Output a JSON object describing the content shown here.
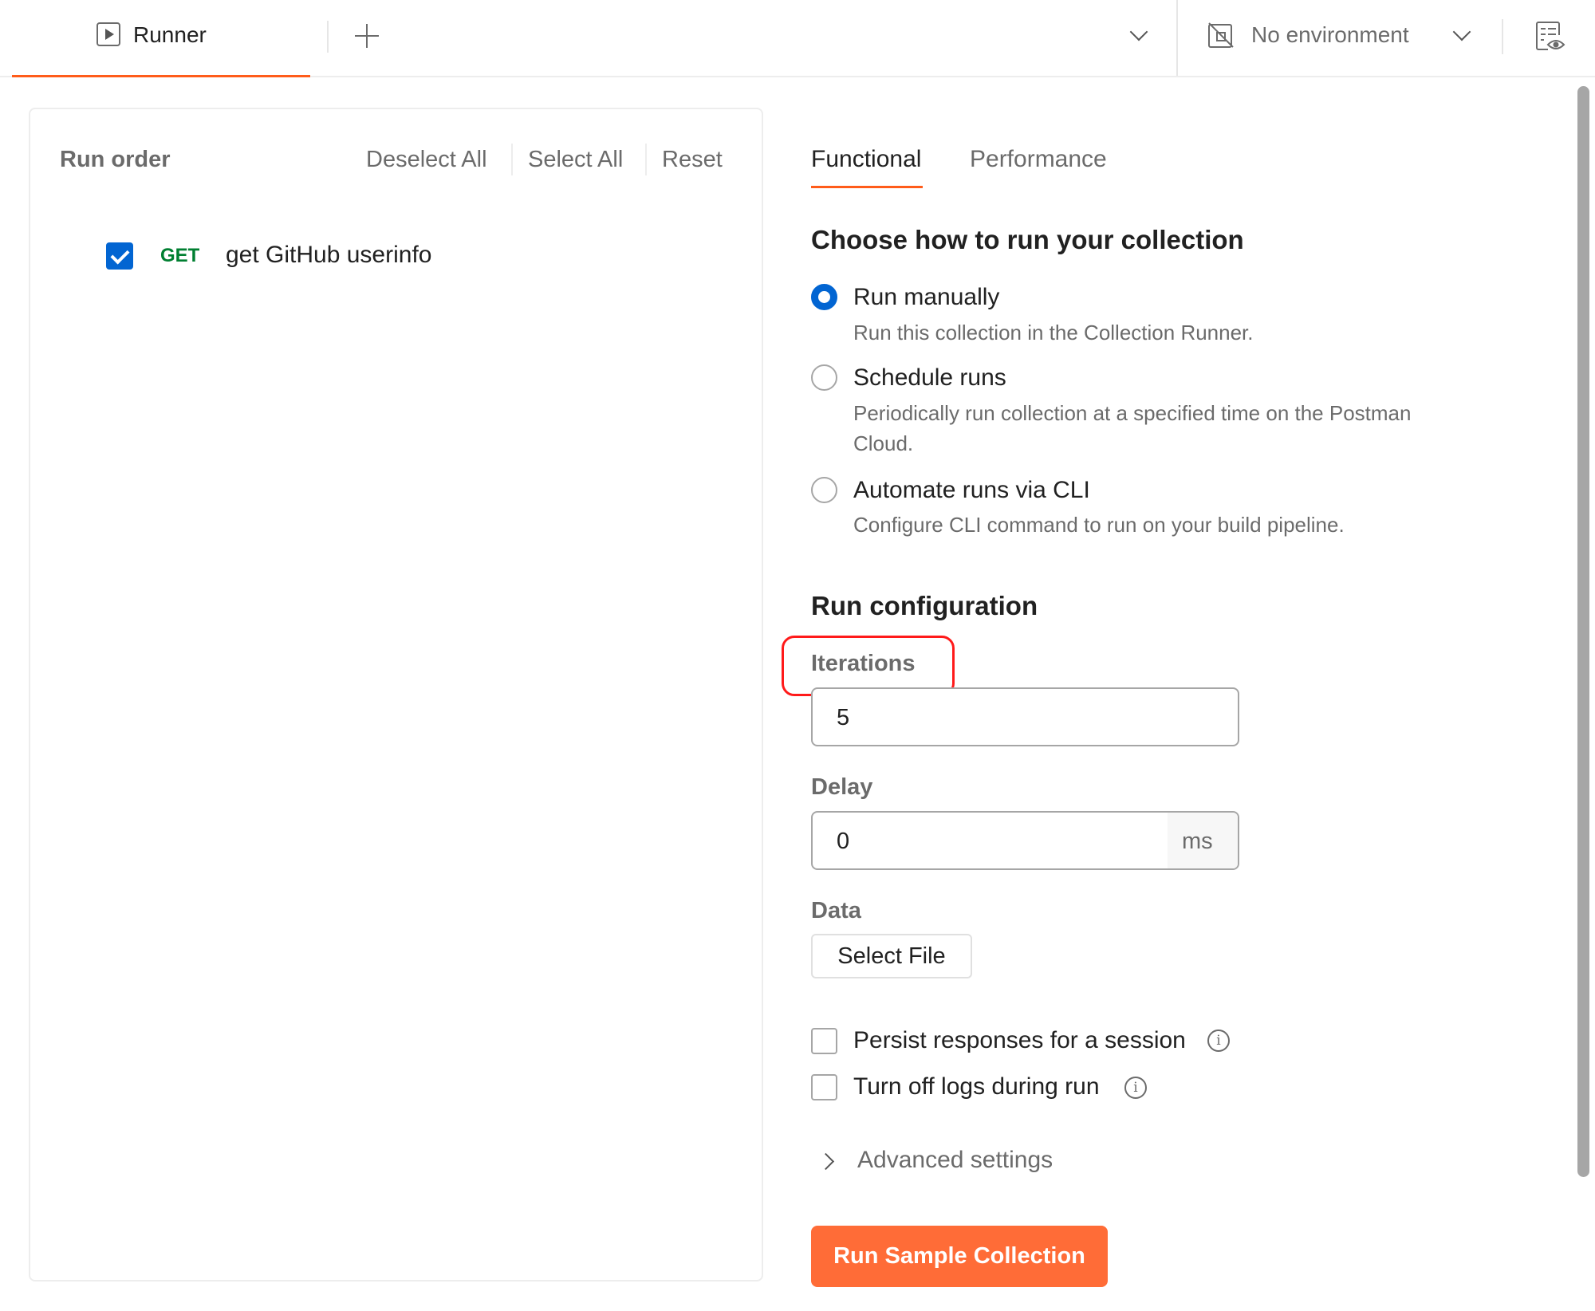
{
  "header": {
    "tab_label": "Runner",
    "tab_icon": "play-square-icon",
    "new_tab_icon": "plus-icon",
    "tabs_menu_icon": "chevron-down-icon",
    "environment": {
      "label": "No environment",
      "icon": "no-environment-icon",
      "dropdown_icon": "chevron-down-icon"
    },
    "view_icon": "environment-quick-look-icon"
  },
  "run_order": {
    "title": "Run order",
    "actions": [
      "Deselect All",
      "Select All",
      "Reset"
    ],
    "requests": [
      {
        "checked": true,
        "method": "GET",
        "name": "get GitHub userinfo"
      }
    ]
  },
  "main": {
    "tabs": [
      {
        "label": "Functional",
        "active": true
      },
      {
        "label": "Performance",
        "active": false
      }
    ],
    "run_mode": {
      "heading": "Choose how to run your collection",
      "options": [
        {
          "label": "Run manually",
          "description": "Run this collection in the Collection Runner.",
          "selected": true
        },
        {
          "label": "Schedule runs",
          "description_line1": "Periodically run collection at a specified time on the Postman",
          "description_line2": "Cloud.",
          "selected": false
        },
        {
          "label": "Automate runs via CLI",
          "description": "Configure CLI command to run on your build pipeline.",
          "selected": false
        }
      ]
    },
    "config": {
      "heading": "Run configuration",
      "iterations": {
        "label": "Iterations",
        "value": "5"
      },
      "delay": {
        "label": "Delay",
        "value": "0",
        "unit": "ms"
      },
      "data": {
        "label": "Data",
        "button": "Select File"
      },
      "checkboxes": [
        {
          "label": "Persist responses for a session",
          "checked": false,
          "info_icon": "info-icon"
        },
        {
          "label": "Turn off logs during run",
          "checked": false,
          "info_icon": "info-icon"
        }
      ],
      "advanced": "Advanced settings"
    },
    "run_button": "Run Sample Collection"
  },
  "colors": {
    "accent": "#ff6c37",
    "tab_underline": "#ff5c1a",
    "checkbox_blue": "#0265d2",
    "method_get": "#007f31",
    "highlight": "#ff1a1a"
  }
}
